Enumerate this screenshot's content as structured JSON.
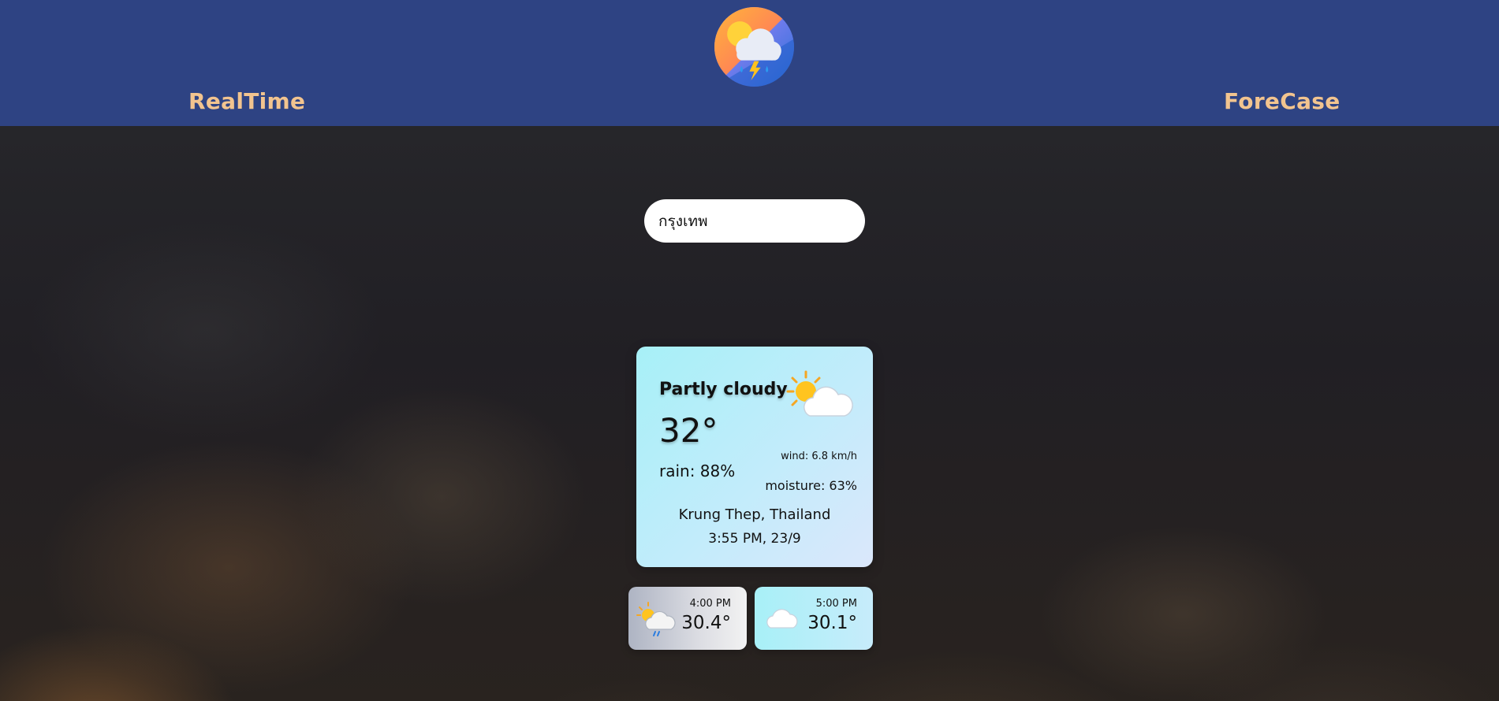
{
  "header": {
    "nav_left": "RealTime",
    "nav_right": "ForeCase",
    "logo_icon": "weather-logo-icon"
  },
  "search": {
    "value": "กรุงเทพ",
    "icon": "none"
  },
  "current": {
    "condition": "Partly cloudy",
    "temperature": "32°",
    "rain": "rain: 88%",
    "wind": "wind: 6.8 km/h",
    "moisture": "moisture: 63%",
    "location": "Krung Thep, Thailand",
    "datetime": "3:55 PM, 23/9",
    "icon": "partly-cloudy-icon"
  },
  "hourly": [
    {
      "time": "4:00 PM",
      "temp": "30.4°",
      "icon": "rain-sun-icon"
    },
    {
      "time": "5:00 PM",
      "temp": "30.1°",
      "icon": "cloud-icon"
    }
  ],
  "colors": {
    "header_bg": "#2e4383",
    "nav_text": "#f2c48f",
    "card_bg_start": "#a7f0f7",
    "card_bg_end": "#dbe7fb"
  }
}
